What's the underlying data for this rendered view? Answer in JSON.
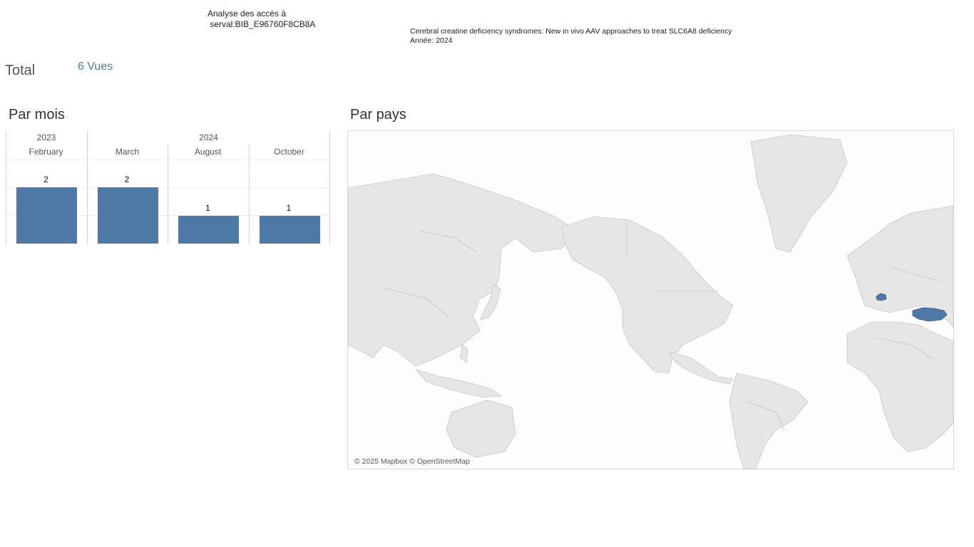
{
  "header": {
    "title": "Analyse des accès à\n serval:BIB_E96760F8CB8A",
    "publication": "Cerebral creatine deficiency syndromes: New in vivo AAV approaches to treat SLC6A8 deficiency",
    "year": "Année: 2024"
  },
  "total": {
    "label": "Total",
    "value": "6 Vues"
  },
  "sections": {
    "monthly": "Par mois",
    "country": "Par pays"
  },
  "map": {
    "attribution": "© 2025 Mapbox © OpenStreetMap",
    "highlighted_countries": [
      "Switzerland",
      "Turkey"
    ],
    "highlight_color": "#4e79a7",
    "land_color": "#e6e6e6"
  },
  "chart_data": {
    "type": "bar",
    "years": [
      {
        "label": "2023",
        "months": [
          "February"
        ]
      },
      {
        "label": "2024",
        "months": [
          "March",
          "August",
          "October"
        ]
      }
    ],
    "categories": [
      "February",
      "March",
      "August",
      "October"
    ],
    "values": [
      2,
      2,
      1,
      1
    ],
    "data_labels": [
      "2",
      "2",
      "1",
      "1"
    ],
    "ylim": [
      0,
      3
    ],
    "grid": true,
    "bar_color": "#4e79a7"
  }
}
